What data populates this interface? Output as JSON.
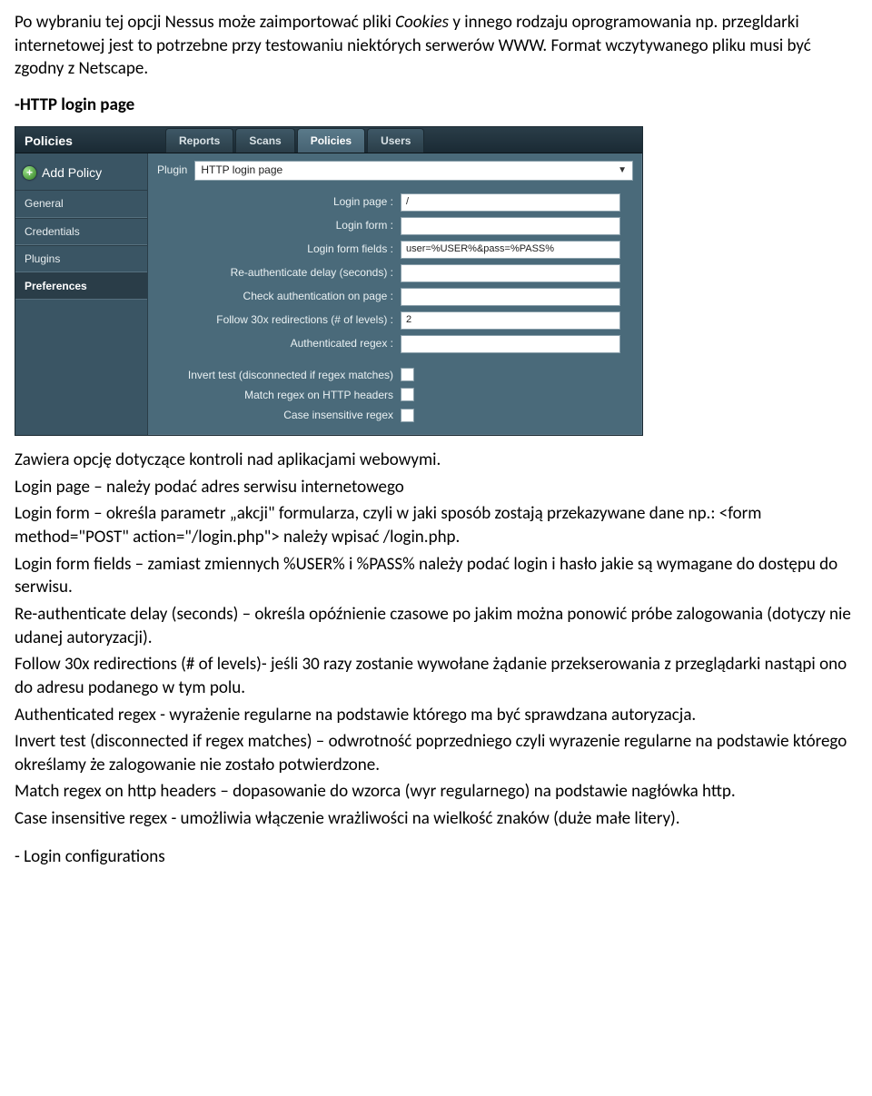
{
  "intro": {
    "p1a": "Po wybraniu tej opcji Nessus może zaimportować pliki ",
    "p1_italic": "Cookies",
    "p1b": " y innego rodzaju oprogramowania np. przegldarki internetowej jest to potrzebne przy testowaniu niektórych serwerów WWW. Format wczytywanego pliku musi być zgodny z Netscape."
  },
  "section1_head": "-HTTP login page",
  "nessus": {
    "title": "Policies",
    "tabs": [
      "Reports",
      "Scans",
      "Policies",
      "Users"
    ],
    "active_tab_index": 2,
    "add_label": "Add Policy",
    "side_items": [
      "General",
      "Credentials",
      "Plugins",
      "Preferences"
    ],
    "side_active_index": 3,
    "plugin_label": "Plugin",
    "plugin_value": "HTTP login page",
    "fields": [
      {
        "label": "Login page :",
        "value": "/"
      },
      {
        "label": "Login form :",
        "value": ""
      },
      {
        "label": "Login form fields :",
        "value": "user=%USER%&pass=%PASS%"
      },
      {
        "label": "Re-authenticate delay (seconds) :",
        "value": ""
      },
      {
        "label": "Check authentication on page :",
        "value": ""
      },
      {
        "label": "Follow 30x redirections (# of levels) :",
        "value": "2"
      },
      {
        "label": "Authenticated regex :",
        "value": ""
      }
    ],
    "checks": [
      "Invert test (disconnected if regex matches)",
      "Match regex on HTTP headers",
      "Case insensitive regex"
    ]
  },
  "desc": {
    "p_zawiera": "Zawiera opcję dotyczące kontroli nad aplikacjami webowymi.",
    "p_login_page": "Login page – należy podać adres serwisu internetowego",
    "p_login_form": "Login form – określa parametr „akcji\" formularza, czyli w jaki sposób zostają przekazywane dane np.: <form method=\"POST\" action=\"/login.php\"> należy wpisać /login.php.",
    "p_login_form_fields": "Login form fields – zamiast zmiennych %USER% i %PASS% należy podać login i hasło jakie są wymagane do dostępu do serwisu.",
    "p_reauth": "Re-authenticate delay (seconds) – określa opóźnienie czasowe po jakim można ponowić próbe zalogowania (dotyczy nie udanej autoryzacji).",
    "p_follow30x": "Follow 30x redirections (# of levels)- jeśli 30 razy zostanie wywołane żądanie przekserowania z przeglądarki nastąpi ono do adresu podanego w tym polu.",
    "p_auth_regex": "Authenticated regex  - wyrażenie regularne na podstawie którego ma być sprawdzana autoryzacja.",
    "p_invert": "Invert test (disconnected if regex matches) – odwrotność poprzedniego czyli wyrazenie regularne na podstawie którego określamy że zalogowanie nie zostało potwierdzone.",
    "p_match_headers": "Match regex on http headers – dopasowanie do wzorca (wyr regularnego) na podstawie nagłówka http.",
    "p_case": "Case insensitive regex  - umożliwia włączenie wrażliwości na wielkość znaków (duże małe litery)."
  },
  "section2_head": "- Login configurations"
}
